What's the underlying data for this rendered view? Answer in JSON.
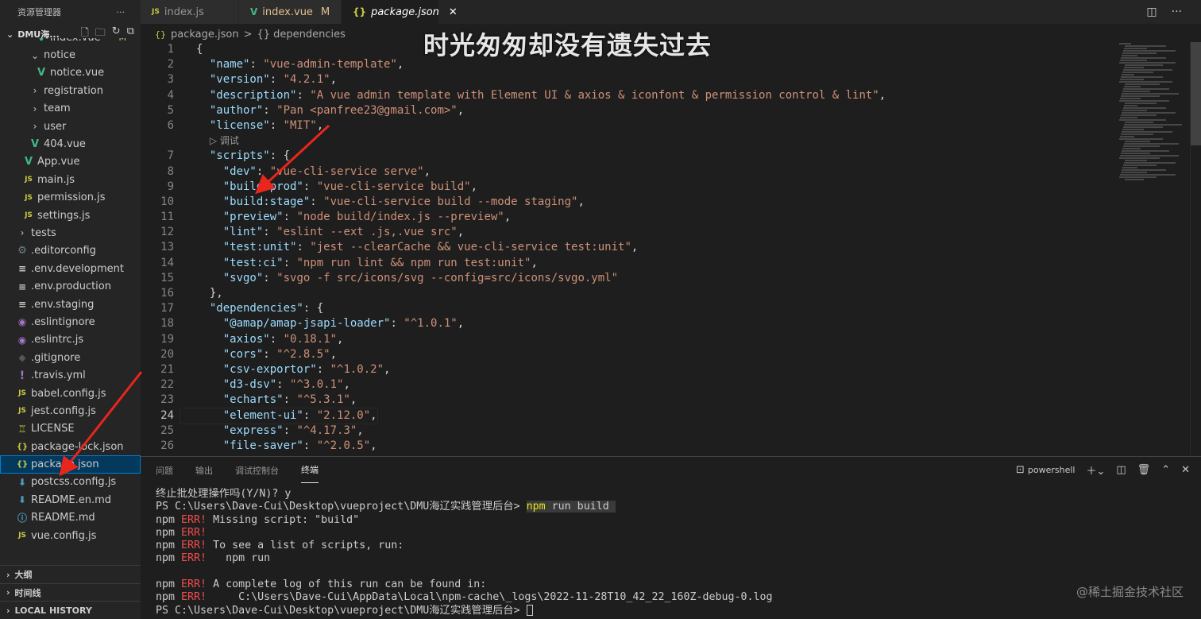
{
  "sidebar": {
    "title": "资源管理器",
    "more": "···",
    "folder": "DMU海...",
    "items": [
      {
        "label": "index.vue",
        "icon": "vue",
        "depth": 3,
        "badge": "M"
      },
      {
        "label": "notice",
        "icon": "chevron-down",
        "depth": 2
      },
      {
        "label": "notice.vue",
        "icon": "vue",
        "depth": 3
      },
      {
        "label": "registration",
        "icon": "chevron-right",
        "depth": 2
      },
      {
        "label": "team",
        "icon": "chevron-right",
        "depth": 2
      },
      {
        "label": "user",
        "icon": "chevron-right",
        "depth": 2
      },
      {
        "label": "404.vue",
        "icon": "vue",
        "depth": 2
      },
      {
        "label": "App.vue",
        "icon": "vue",
        "depth": 1
      },
      {
        "label": "main.js",
        "icon": "js",
        "depth": 1
      },
      {
        "label": "permission.js",
        "icon": "js",
        "depth": 1
      },
      {
        "label": "settings.js",
        "icon": "js",
        "depth": 1
      },
      {
        "label": "tests",
        "icon": "chevron-right",
        "depth": 0
      },
      {
        "label": ".editorconfig",
        "icon": "gear",
        "depth": 0
      },
      {
        "label": ".env.development",
        "icon": "lines",
        "depth": 0
      },
      {
        "label": ".env.production",
        "icon": "lines",
        "depth": 0
      },
      {
        "label": ".env.staging",
        "icon": "lines",
        "depth": 0
      },
      {
        "label": ".eslintignore",
        "icon": "lint",
        "depth": 0
      },
      {
        "label": ".eslintrc.js",
        "icon": "lint",
        "depth": 0
      },
      {
        "label": ".gitignore",
        "icon": "git",
        "depth": 0
      },
      {
        "label": ".travis.yml",
        "icon": "yml",
        "depth": 0
      },
      {
        "label": "babel.config.js",
        "icon": "js",
        "depth": 0
      },
      {
        "label": "jest.config.js",
        "icon": "js",
        "depth": 0
      },
      {
        "label": "LICENSE",
        "icon": "license",
        "depth": 0
      },
      {
        "label": "package-lock.json",
        "icon": "json",
        "depth": 0
      },
      {
        "label": "package.json",
        "icon": "json",
        "depth": 0,
        "selected": true
      },
      {
        "label": "postcss.config.js",
        "icon": "postcss",
        "depth": 0
      },
      {
        "label": "README.en.md",
        "icon": "md",
        "depth": 0
      },
      {
        "label": "README.md",
        "icon": "info",
        "depth": 0
      },
      {
        "label": "vue.config.js",
        "icon": "js",
        "depth": 0
      }
    ],
    "sections": [
      "大纲",
      "时间线",
      "LOCAL HISTORY"
    ]
  },
  "tabs": [
    {
      "label": "index.js",
      "icon": "JS",
      "active": false
    },
    {
      "label": "index.vue",
      "icon": "V",
      "active": false,
      "mod": "M"
    },
    {
      "label": "package.json",
      "icon": "{}",
      "active": true,
      "close": "✕"
    }
  ],
  "breadcrumb": {
    "file": "package.json",
    "sep": ">",
    "node": "{} dependencies"
  },
  "overlay_title": "时光匆匆却没有遗失过去",
  "editor": {
    "current_line": 24,
    "lens": "▷ 调试",
    "lines": [
      {
        "n": "1",
        "parts": [
          [
            "pun",
            "{"
          ]
        ]
      },
      {
        "n": "2",
        "parts": [
          [
            "pun",
            "  "
          ],
          [
            "key",
            "\"name\""
          ],
          [
            "pun",
            ": "
          ],
          [
            "str",
            "\"vue-admin-template\""
          ],
          [
            "pun",
            ","
          ]
        ]
      },
      {
        "n": "3",
        "parts": [
          [
            "pun",
            "  "
          ],
          [
            "key",
            "\"version\""
          ],
          [
            "pun",
            ": "
          ],
          [
            "str",
            "\"4.2.1\""
          ],
          [
            "pun",
            ","
          ]
        ]
      },
      {
        "n": "4",
        "parts": [
          [
            "pun",
            "  "
          ],
          [
            "key",
            "\"description\""
          ],
          [
            "pun",
            ": "
          ],
          [
            "str",
            "\"A vue admin template with Element UI & axios & iconfont & permission control & lint\""
          ],
          [
            "pun",
            ","
          ]
        ]
      },
      {
        "n": "5",
        "parts": [
          [
            "pun",
            "  "
          ],
          [
            "key",
            "\"author\""
          ],
          [
            "pun",
            ": "
          ],
          [
            "str",
            "\"Pan <panfree23@gmail.com>\""
          ],
          [
            "pun",
            ","
          ]
        ]
      },
      {
        "n": "6",
        "parts": [
          [
            "pun",
            "  "
          ],
          [
            "key",
            "\"license\""
          ],
          [
            "pun",
            ": "
          ],
          [
            "str",
            "\"MIT\""
          ],
          [
            "pun",
            ","
          ]
        ]
      },
      {
        "n": "",
        "lens": true
      },
      {
        "n": "7",
        "parts": [
          [
            "pun",
            "  "
          ],
          [
            "key",
            "\"scripts\""
          ],
          [
            "pun",
            ": {"
          ]
        ]
      },
      {
        "n": "8",
        "parts": [
          [
            "pun",
            "    "
          ],
          [
            "key",
            "\"dev\""
          ],
          [
            "pun",
            ": "
          ],
          [
            "str",
            "\"vue-cli-service serve\""
          ],
          [
            "pun",
            ","
          ]
        ]
      },
      {
        "n": "9",
        "parts": [
          [
            "pun",
            "    "
          ],
          [
            "key",
            "\"build:prod\""
          ],
          [
            "pun",
            ": "
          ],
          [
            "str",
            "\"vue-cli-service build\""
          ],
          [
            "pun",
            ","
          ]
        ]
      },
      {
        "n": "10",
        "parts": [
          [
            "pun",
            "    "
          ],
          [
            "key",
            "\"build:stage\""
          ],
          [
            "pun",
            ": "
          ],
          [
            "str",
            "\"vue-cli-service build --mode staging\""
          ],
          [
            "pun",
            ","
          ]
        ]
      },
      {
        "n": "11",
        "parts": [
          [
            "pun",
            "    "
          ],
          [
            "key",
            "\"preview\""
          ],
          [
            "pun",
            ": "
          ],
          [
            "str",
            "\"node build/index.js --preview\""
          ],
          [
            "pun",
            ","
          ]
        ]
      },
      {
        "n": "12",
        "parts": [
          [
            "pun",
            "    "
          ],
          [
            "key",
            "\"lint\""
          ],
          [
            "pun",
            ": "
          ],
          [
            "str",
            "\"eslint --ext .js,.vue src\""
          ],
          [
            "pun",
            ","
          ]
        ]
      },
      {
        "n": "13",
        "parts": [
          [
            "pun",
            "    "
          ],
          [
            "key",
            "\"test:unit\""
          ],
          [
            "pun",
            ": "
          ],
          [
            "str",
            "\"jest --clearCache && vue-cli-service test:unit\""
          ],
          [
            "pun",
            ","
          ]
        ]
      },
      {
        "n": "14",
        "parts": [
          [
            "pun",
            "    "
          ],
          [
            "key",
            "\"test:ci\""
          ],
          [
            "pun",
            ": "
          ],
          [
            "str",
            "\"npm run lint && npm run test:unit\""
          ],
          [
            "pun",
            ","
          ]
        ]
      },
      {
        "n": "15",
        "parts": [
          [
            "pun",
            "    "
          ],
          [
            "key",
            "\"svgo\""
          ],
          [
            "pun",
            ": "
          ],
          [
            "str",
            "\"svgo -f src/icons/svg --config=src/icons/svgo.yml\""
          ]
        ]
      },
      {
        "n": "16",
        "parts": [
          [
            "pun",
            "  },"
          ]
        ]
      },
      {
        "n": "17",
        "parts": [
          [
            "pun",
            "  "
          ],
          [
            "key",
            "\"dependencies\""
          ],
          [
            "pun",
            ": {"
          ]
        ]
      },
      {
        "n": "18",
        "parts": [
          [
            "pun",
            "    "
          ],
          [
            "key",
            "\"@amap/amap-jsapi-loader\""
          ],
          [
            "pun",
            ": "
          ],
          [
            "str",
            "\"^1.0.1\""
          ],
          [
            "pun",
            ","
          ]
        ]
      },
      {
        "n": "19",
        "parts": [
          [
            "pun",
            "    "
          ],
          [
            "key",
            "\"axios\""
          ],
          [
            "pun",
            ": "
          ],
          [
            "str",
            "\"0.18.1\""
          ],
          [
            "pun",
            ","
          ]
        ]
      },
      {
        "n": "20",
        "parts": [
          [
            "pun",
            "    "
          ],
          [
            "key",
            "\"cors\""
          ],
          [
            "pun",
            ": "
          ],
          [
            "str",
            "\"^2.8.5\""
          ],
          [
            "pun",
            ","
          ]
        ]
      },
      {
        "n": "21",
        "parts": [
          [
            "pun",
            "    "
          ],
          [
            "key",
            "\"csv-exportor\""
          ],
          [
            "pun",
            ": "
          ],
          [
            "str",
            "\"^1.0.2\""
          ],
          [
            "pun",
            ","
          ]
        ]
      },
      {
        "n": "22",
        "parts": [
          [
            "pun",
            "    "
          ],
          [
            "key",
            "\"d3-dsv\""
          ],
          [
            "pun",
            ": "
          ],
          [
            "str",
            "\"^3.0.1\""
          ],
          [
            "pun",
            ","
          ]
        ]
      },
      {
        "n": "23",
        "parts": [
          [
            "pun",
            "    "
          ],
          [
            "key",
            "\"echarts\""
          ],
          [
            "pun",
            ": "
          ],
          [
            "str",
            "\"^5.3.1\""
          ],
          [
            "pun",
            ","
          ]
        ]
      },
      {
        "n": "24",
        "parts": [
          [
            "pun",
            "    "
          ],
          [
            "key",
            "\"element-ui\""
          ],
          [
            "pun",
            ": "
          ],
          [
            "str",
            "\"2.12.0\""
          ],
          [
            "pun",
            ","
          ]
        ]
      },
      {
        "n": "25",
        "parts": [
          [
            "pun",
            "    "
          ],
          [
            "key",
            "\"express\""
          ],
          [
            "pun",
            ": "
          ],
          [
            "str",
            "\"^4.17.3\""
          ],
          [
            "pun",
            ","
          ]
        ]
      },
      {
        "n": "26",
        "parts": [
          [
            "pun",
            "    "
          ],
          [
            "key",
            "\"file-saver\""
          ],
          [
            "pun",
            ": "
          ],
          [
            "str",
            "\"^2.0.5\""
          ],
          [
            "pun",
            ","
          ]
        ]
      }
    ]
  },
  "panel": {
    "tabs": [
      "问题",
      "输出",
      "调试控制台",
      "终端"
    ],
    "active_tab": "终端",
    "shell": "powershell",
    "terminal": [
      {
        "t": "plain",
        "text": "终止批处理操作吗(Y/N)? y"
      },
      {
        "t": "prompt",
        "prompt": "PS C:\\Users\\Dave-Cui\\Desktop\\vueproject\\DMU海辽实践管理后台> ",
        "npm": "npm",
        "rest": " run build "
      },
      {
        "t": "err",
        "pre": "npm ",
        "err": "ERR!",
        "rest": " Missing script: \"build\""
      },
      {
        "t": "err",
        "pre": "npm ",
        "err": "ERR!",
        "rest": ""
      },
      {
        "t": "err",
        "pre": "npm ",
        "err": "ERR!",
        "rest": " To see a list of scripts, run:"
      },
      {
        "t": "err",
        "pre": "npm ",
        "err": "ERR!",
        "rest": "   npm run"
      },
      {
        "t": "plain",
        "text": ""
      },
      {
        "t": "err",
        "pre": "npm ",
        "err": "ERR!",
        "rest": " A complete log of this run can be found in:"
      },
      {
        "t": "err",
        "pre": "npm ",
        "err": "ERR!",
        "rest": "     C:\\Users\\Dave-Cui\\AppData\\Local\\npm-cache\\_logs\\2022-11-28T10_42_22_160Z-debug-0.log"
      },
      {
        "t": "final",
        "text": "PS C:\\Users\\Dave-Cui\\Desktop\\vueproject\\DMU海辽实践管理后台> "
      }
    ]
  },
  "watermark": "@稀土掘金技术社区",
  "colors": {
    "accent": "#007fd4",
    "arrow": "#e8261c",
    "key": "#9cdcfe",
    "string": "#ce9178"
  }
}
